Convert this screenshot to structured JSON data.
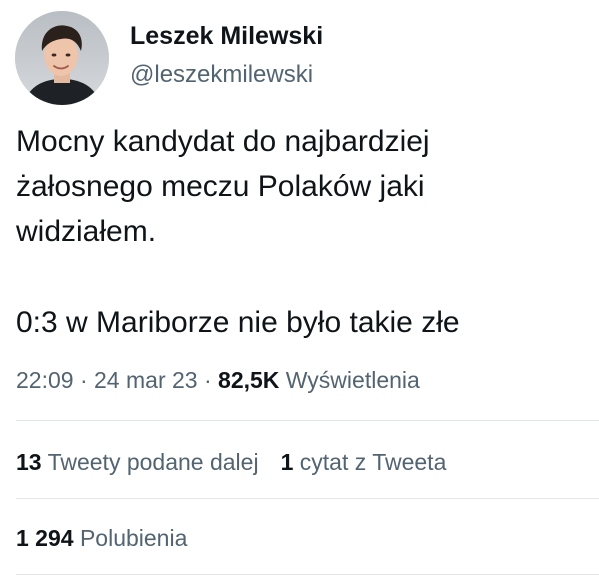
{
  "author": {
    "display_name": "Leszek Milewski",
    "handle": "@leszekmilewski"
  },
  "tweet": {
    "text_lines": [
      "Mocny kandydat do najbardziej",
      "żałosnego meczu Polaków jaki",
      "widziałem.",
      "0:3 w Mariborze nie było takie złe"
    ],
    "time": "22:09",
    "date": "24 mar 23",
    "separator": "·",
    "views_count": "82,5K",
    "views_label": "Wyświetlenia"
  },
  "stats": {
    "retweets_count": "13",
    "retweets_label": "Tweety podane dalej",
    "quotes_count": "1",
    "quotes_label": "cytat z Tweeta",
    "likes_count": "1 294",
    "likes_label": "Polubienia"
  },
  "icons": {
    "avatar": "profile-photo"
  },
  "colors": {
    "primary_text": "#0f1419",
    "secondary_text": "#536471",
    "divider": "#e3e6e9"
  }
}
